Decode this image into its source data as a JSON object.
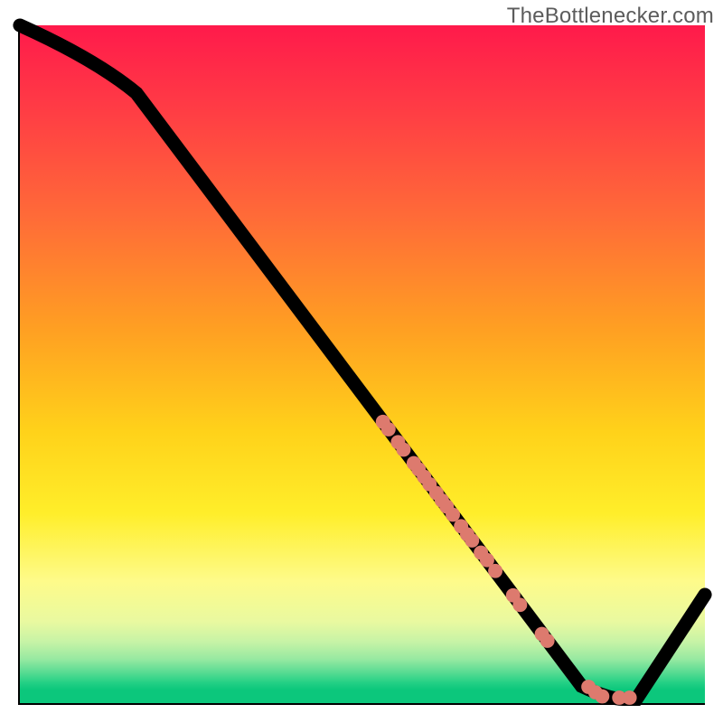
{
  "watermark": "TheBottlenecker.com",
  "chart_data": {
    "type": "line",
    "title": "",
    "xlabel": "",
    "ylabel": "",
    "xlim": [
      0,
      100
    ],
    "ylim": [
      0,
      100
    ],
    "grid": false,
    "series": [
      {
        "name": "curve",
        "points": [
          [
            0,
            100
          ],
          [
            11,
            95
          ],
          [
            17,
            90
          ],
          [
            82,
            2.5
          ],
          [
            86,
            0.6
          ],
          [
            90,
            0.6
          ],
          [
            100,
            16
          ]
        ]
      }
    ],
    "markers": {
      "name": "dots-on-curve",
      "color": "#dd7a6e",
      "points": [
        [
          53.0,
          41.5
        ],
        [
          53.8,
          40.4
        ],
        [
          55.2,
          38.5
        ],
        [
          56.0,
          37.4
        ],
        [
          57.5,
          35.4
        ],
        [
          58.2,
          34.5
        ],
        [
          59.0,
          33.4
        ],
        [
          59.8,
          32.3
        ],
        [
          60.8,
          31.0
        ],
        [
          61.6,
          29.9
        ],
        [
          62.3,
          29.0
        ],
        [
          63.2,
          27.8
        ],
        [
          64.4,
          26.1
        ],
        [
          65.3,
          24.9
        ],
        [
          66.0,
          24.0
        ],
        [
          67.3,
          22.2
        ],
        [
          68.2,
          21.1
        ],
        [
          69.4,
          19.5
        ],
        [
          72.0,
          15.9
        ],
        [
          73.0,
          14.5
        ],
        [
          76.2,
          10.2
        ],
        [
          77.0,
          9.2
        ],
        [
          83.0,
          2.4
        ],
        [
          84.0,
          1.6
        ],
        [
          85.0,
          1.0
        ],
        [
          87.5,
          0.8
        ],
        [
          89.0,
          0.8
        ]
      ]
    },
    "background": {
      "type": "vertical-gradient",
      "stops": [
        {
          "pos": 0.0,
          "color": "#ff1a4b"
        },
        {
          "pos": 0.45,
          "color": "#ffa022"
        },
        {
          "pos": 0.72,
          "color": "#ffee2a"
        },
        {
          "pos": 0.97,
          "color": "#0cc77c"
        }
      ]
    }
  }
}
